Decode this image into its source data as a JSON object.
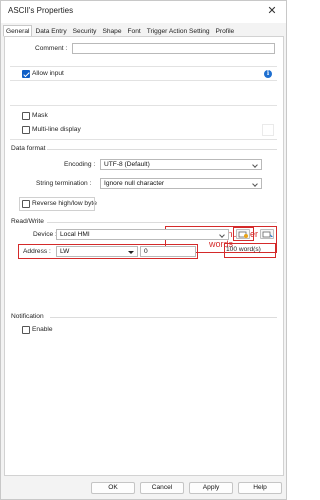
{
  "window": {
    "title": "ASCII's Properties",
    "close_glyph": "✕"
  },
  "tabs": [
    "General",
    "Data Entry",
    "Security",
    "Shape",
    "Font",
    "Trigger Action Setting",
    "Profile"
  ],
  "general": {
    "comment_label": "Comment :",
    "comment_value": "",
    "allow_input_label": "Allow input",
    "allow_input_checked": true,
    "mask_label": "Mask",
    "multiline_label": "Multi-line display"
  },
  "data_format": {
    "group_label": "Data format",
    "encoding_label": "Encoding :",
    "encoding_value": "UTF-8 (Default)",
    "termination_label": "String termination :",
    "termination_value": "Ignore null character",
    "reverse_label": "Reverse high/low byte"
  },
  "read_write": {
    "group_label": "Read/Write",
    "device_label": "Device :",
    "device_value": "Local HMI",
    "address_label": "Address :",
    "address_type": "LW",
    "address_value": "0",
    "words_value": "100 word(s)"
  },
  "annotation": {
    "callout_text": "Change max number of words",
    "color": "#d42a2a"
  },
  "notification": {
    "group_label": "Notification",
    "enable_label": "Enable"
  },
  "buttons": {
    "ok": "OK",
    "cancel": "Cancel",
    "apply": "Apply",
    "help": "Help"
  },
  "icons": {
    "info": "info-icon",
    "settings": "address-settings-icon",
    "pick": "address-pick-icon"
  },
  "colors": {
    "accent": "#0f5fc6",
    "annotation": "#d42a2a"
  }
}
